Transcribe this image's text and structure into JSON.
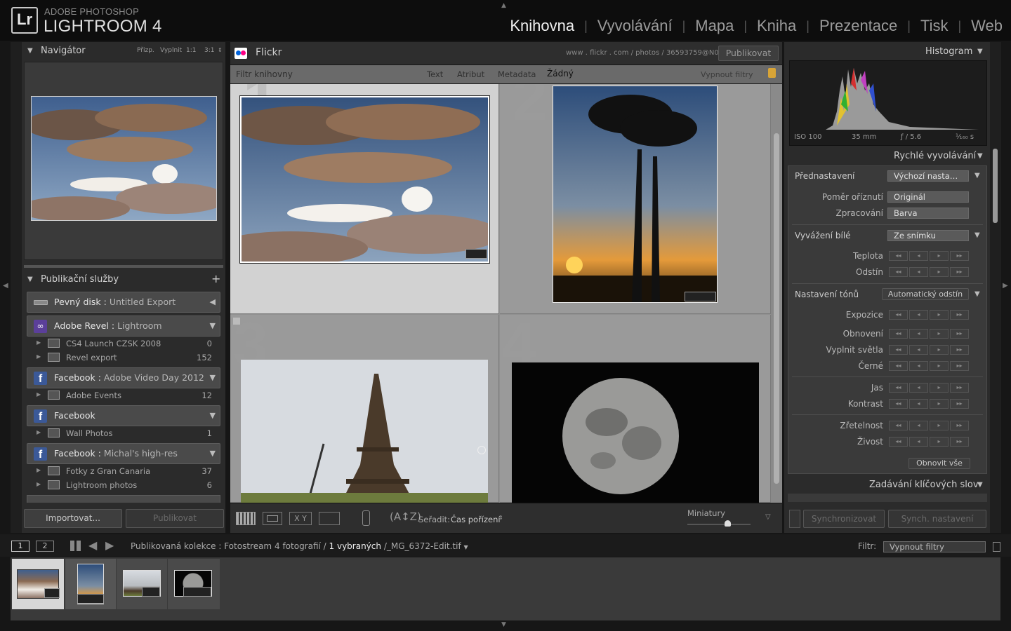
{
  "identity": {
    "brand_line1": "ADOBE PHOTOSHOP",
    "brand_line2": "LIGHTROOM 4",
    "logo": "Lr",
    "modules": [
      "Knihovna",
      "Vyvolávání",
      "Mapa",
      "Kniha",
      "Prezentace",
      "Tisk",
      "Web"
    ],
    "active_module": "Knihovna"
  },
  "navigator": {
    "title": "Navigátor",
    "zoom_options": [
      "Přizp.",
      "Vyplnit",
      "1:1",
      "3:1"
    ]
  },
  "publish": {
    "title": "Publikační služby",
    "add": "+",
    "services": [
      {
        "name": "Pevný disk",
        "sub": "Untitled Export",
        "icon": "disk-icon"
      },
      {
        "name": "Adobe Revel",
        "sub": "Lightroom",
        "icon": "revel-icon",
        "collections": [
          {
            "label": "CS4 Launch CZSK 2008",
            "count": "0"
          },
          {
            "label": "Revel export",
            "count": "152"
          }
        ]
      },
      {
        "name": "Facebook",
        "sub": "Adobe Video Day 2012",
        "icon": "facebook-icon",
        "collections": [
          {
            "label": "Adobe Events",
            "count": "12"
          }
        ]
      },
      {
        "name": "Facebook",
        "sub": "",
        "icon": "facebook-icon",
        "collections": [
          {
            "label": "Wall Photos",
            "count": "1"
          }
        ]
      },
      {
        "name": "Facebook",
        "sub": "Michal's high-res",
        "icon": "facebook-icon",
        "collections": [
          {
            "label": "Fotky z Gran Canaria",
            "count": "37"
          },
          {
            "label": "Lightroom photos",
            "count": "6"
          }
        ]
      }
    ],
    "import_label": "Importovat...",
    "publish_label": "Publikovat"
  },
  "center": {
    "service_title": "Flickr",
    "url": "www . flickr . com / photos / 36593759@N07",
    "publish_button": "Publikovat",
    "filter_label": "Filtr knihovny",
    "filter_tabs": [
      "Text",
      "Atribut",
      "Metadata",
      "Žádný"
    ],
    "filter_active": "Žádný",
    "filter_off": "Vypnout filtry",
    "cell_numbers": [
      "1",
      "2",
      "3",
      "4"
    ],
    "sort_label": "Seřadit:",
    "sort_value": "Čas pořízení",
    "thumbs_label": "Miniatury",
    "thumb_size": 0.5
  },
  "right": {
    "histogram_title": "Histogram",
    "iso": "ISO 100",
    "focal": "35 mm",
    "aperture": "ƒ / 5.6",
    "shutter": "¹⁄₁₆₀ s",
    "quick_title": "Rychlé vyvolávání",
    "preset_label": "Přednastavení",
    "preset_value": "Výchozí nasta…",
    "crop_label": "Poměr oříznutí",
    "crop_value": "Originál",
    "treatment_label": "Zpracování",
    "treatment_value": "Barva",
    "wb_label": "Vyvážení bílé",
    "wb_value": "Ze snímku",
    "temp_label": "Teplota",
    "tint_label": "Odstín",
    "tone_label": "Nastavení tónů",
    "auto_tone": "Automatický odstín",
    "tone_rows": [
      "Expozice",
      "Obnovení",
      "Vyplnit světla",
      "Černé"
    ],
    "bright_rows": [
      "Jas",
      "Kontrast"
    ],
    "clarity_rows": [
      "Zřetelnost",
      "Živost"
    ],
    "reset_all": "Obnovit vše",
    "keywording_title": "Zadávání klíčových slov",
    "sync_label": "Synchronizovat",
    "sync_settings_label": "Synch. nastavení"
  },
  "filmbar": {
    "screen1": "1",
    "screen2": "2",
    "collection_prefix": "Publikovaná kolekce : ",
    "collection_name": "Fotostream",
    "count_text": "4 fotografií / ",
    "selected_text": "1 vybraných",
    "file_text": " /_MG_6372-Edit.tif",
    "filter_label": "Filtr:",
    "filter_value": "Vypnout filtry"
  }
}
